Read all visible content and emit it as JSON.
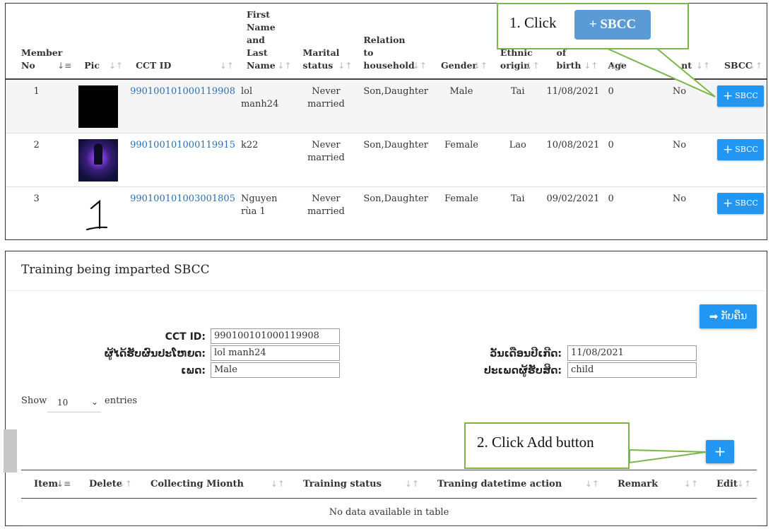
{
  "members_table": {
    "columns": [
      {
        "label": "Member No",
        "lines": [
          "Member",
          "No"
        ],
        "sort": "asc"
      },
      {
        "label": "Pic",
        "lines": [
          "Pic"
        ],
        "sort": "none"
      },
      {
        "label": "CCT ID",
        "lines": [
          "CCT ID"
        ],
        "sort": "none"
      },
      {
        "label": "First Name and Last Name",
        "lines": [
          "First",
          "Name",
          "and",
          "Last",
          "Name"
        ],
        "sort": "none"
      },
      {
        "label": "Marital status",
        "lines": [
          "Marital",
          "status"
        ],
        "sort": "none"
      },
      {
        "label": "Relation to household",
        "lines": [
          "Relation",
          "to",
          "household"
        ],
        "sort": "none"
      },
      {
        "label": "Gender",
        "lines": [
          "Gender"
        ],
        "sort": "none"
      },
      {
        "label": "Ethnic origin",
        "lines": [
          "Ethnic",
          "origin"
        ],
        "sort": "none"
      },
      {
        "label": "of birth",
        "lines": [
          "of",
          "birth"
        ],
        "sort": "none"
      },
      {
        "label": "Age",
        "lines": [
          "Age"
        ],
        "sort": "none"
      },
      {
        "label": "nt",
        "lines": [
          "nt"
        ],
        "sort": "none"
      },
      {
        "label": "SBCC",
        "lines": [
          "SBCC"
        ],
        "sort": "none"
      }
    ],
    "rows": [
      {
        "no": "1",
        "pic": "black-image",
        "cct_id": "990100101000119908",
        "name": "lol manh24",
        "marital": "Never married",
        "relation": "Son,Daughter",
        "gender": "Male",
        "ethnic": "Tai",
        "dob": "11/08/2021",
        "age": "0",
        "col11": "No",
        "button": "SBCC"
      },
      {
        "no": "2",
        "pic": "concert-image",
        "cct_id": "990100101000119915",
        "name": "k22",
        "marital": "Never married",
        "relation": "Son,Daughter",
        "gender": "Female",
        "ethnic": "Lao",
        "dob": "10/08/2021",
        "age": "0",
        "col11": "No",
        "button": "SBCC"
      },
      {
        "no": "3",
        "pic": "handwritten-one-image",
        "cct_id": "990100101003001805",
        "name": "Nguyen rùa 1",
        "marital": "Never married",
        "relation": "Son,Daughter",
        "gender": "Female",
        "ethnic": "Tai",
        "dob": "09/02/2021",
        "age": "0",
        "col11": "No",
        "button": "SBCC"
      }
    ]
  },
  "callout1": {
    "text": "1. Click",
    "button": "+ SBCC"
  },
  "callout2": {
    "text": "2. Click Add button"
  },
  "training": {
    "title": "Training being imparted SBCC",
    "back_button": "ກັບຄືນ",
    "fields": {
      "cct_id_label": "CCT ID:",
      "cct_id_value": "990100101000119908",
      "beneficiary_label": "ຜູ້ໄດ້ຮັບຜົນປະໂຫຍດ:",
      "beneficiary_value": "lol manh24",
      "gender_label": "ເພດ:",
      "gender_value": "Male",
      "dob_label": "ວັນເດືອນປີເກີດ:",
      "dob_value": "11/08/2021",
      "type_label": "ປະເພດຜູ້ຮັບສິດ:",
      "type_value": "child"
    },
    "show_label": "Show",
    "show_value": "10",
    "entries_label": "entries",
    "add_button": "+",
    "columns": [
      {
        "label": "Item",
        "sort": "asc"
      },
      {
        "label": "Delete",
        "sort": "none"
      },
      {
        "label": "Collecting Mionth",
        "sort": "none"
      },
      {
        "label": "Training status",
        "sort": "none"
      },
      {
        "label": "Traning datetime action",
        "sort": "none"
      },
      {
        "label": "Remark",
        "sort": "none"
      },
      {
        "label": "Edit",
        "sort": "none"
      }
    ],
    "empty_text": "No data available in table"
  },
  "colors": {
    "accent": "#2196f3",
    "callout_border": "#7ab648",
    "link": "#2a6fb0"
  }
}
